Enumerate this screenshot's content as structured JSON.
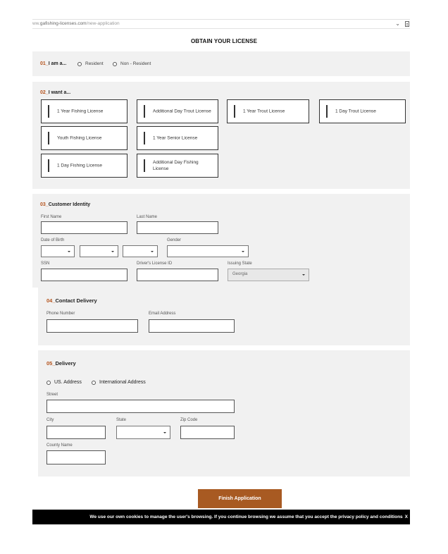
{
  "url": {
    "prefix": "ww.",
    "domain": "gafishing-licenses.com",
    "path": "/new-application"
  },
  "page_title": "OBTAIN YOUR LICENSE",
  "section1": {
    "num": "01_",
    "title": "I am a...",
    "options": [
      "Resident",
      "Non - Resident"
    ]
  },
  "section2": {
    "num": "02_",
    "title": "I want a...",
    "options": [
      "1 Year Fishing License",
      "Additional Day Trout License",
      "1 Year Trout License",
      "1 Day Trout License",
      "Youth Fishing License",
      "1 Year Senior License",
      "1 Day Fishing License",
      "Additional Day Fishing License"
    ]
  },
  "section3": {
    "num": "03_",
    "title": "Customer Identity",
    "labels": {
      "first_name": "First Name",
      "last_name": "Last Name",
      "dob": "Date of Birth",
      "gender": "Gender",
      "ssn": "SSN",
      "drivers_license": "Driver's License ID",
      "issuing_state": "Issuing State"
    },
    "issuing_state_value": "Georgia"
  },
  "section4": {
    "num": "04_",
    "title": "Contact Delivery",
    "labels": {
      "phone": "Phone Number",
      "email": "Email Address"
    }
  },
  "section5": {
    "num": "05_",
    "title": "Delivery",
    "options": [
      "US. Address",
      "International Address"
    ],
    "labels": {
      "street": "Street",
      "city": "City",
      "state": "State",
      "zip": "Zip Code",
      "county": "County Name"
    }
  },
  "finish_button": "Finish Application",
  "cookie": {
    "text": "We use our own cookies to manage the user's browsing. If you continue browsing we assume that you accept the privacy policy and conditions",
    "close": "X"
  }
}
